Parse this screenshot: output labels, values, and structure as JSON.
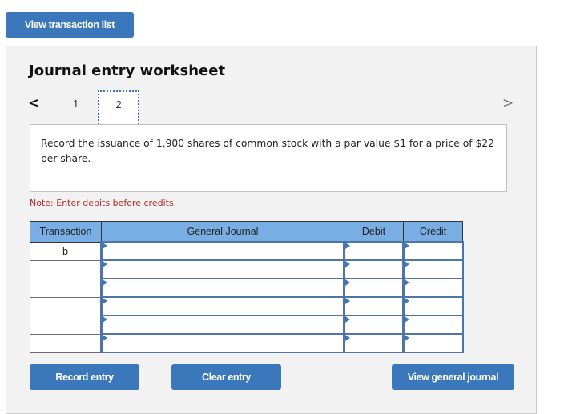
{
  "top_button": {
    "label": "View transaction list"
  },
  "worksheet": {
    "title": "Journal entry worksheet",
    "nav": {
      "prev_icon": "chevron-left-icon",
      "next_icon": "chevron-right-icon",
      "prev_glyph": "<",
      "next_glyph": ">",
      "tabs": [
        {
          "label": "1",
          "active": false
        },
        {
          "label": "2",
          "active": true
        }
      ]
    },
    "prompt": "Record the issuance of 1,900 shares of common stock with a par value $1 for a price of $22 per share.",
    "note": "Note: Enter debits before credits.",
    "table": {
      "headers": [
        "Transaction",
        "General Journal",
        "Debit",
        "Credit"
      ],
      "rows": [
        {
          "transaction": "b",
          "account": "",
          "debit": "",
          "credit": ""
        },
        {
          "transaction": "",
          "account": "",
          "debit": "",
          "credit": ""
        },
        {
          "transaction": "",
          "account": "",
          "debit": "",
          "credit": ""
        },
        {
          "transaction": "",
          "account": "",
          "debit": "",
          "credit": ""
        },
        {
          "transaction": "",
          "account": "",
          "debit": "",
          "credit": ""
        },
        {
          "transaction": "",
          "account": "",
          "debit": "",
          "credit": ""
        }
      ]
    },
    "buttons": {
      "record": "Record entry",
      "clear": "Clear entry",
      "view_journal": "View general journal"
    }
  },
  "colors": {
    "button_blue": "#3a78bb",
    "header_blue": "#78aee3",
    "note_red": "#b22a2a",
    "panel_bg": "#f2f2f2"
  }
}
